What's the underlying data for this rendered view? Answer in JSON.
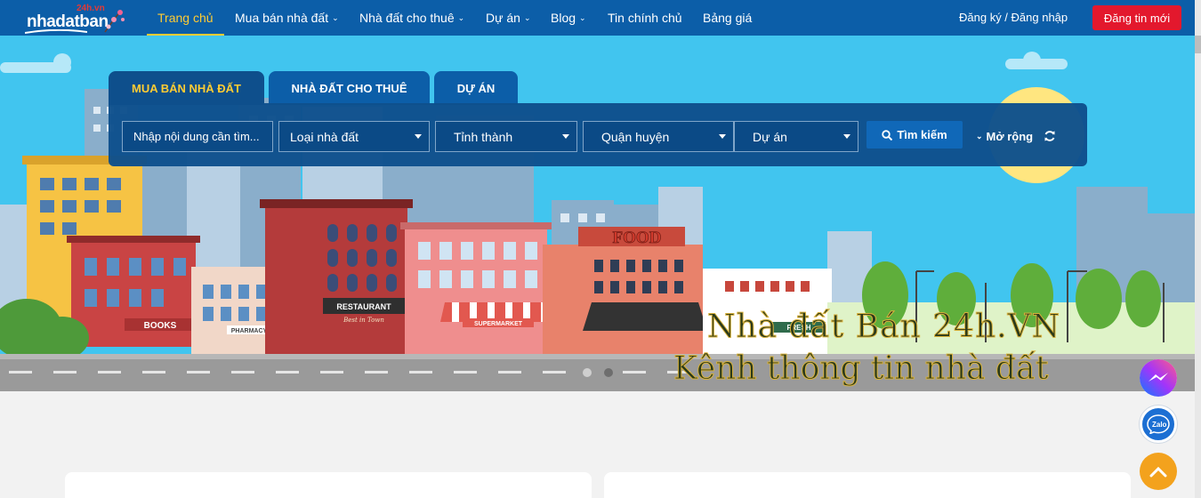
{
  "header": {
    "logo_text": "nhadatban",
    "logo_tag": "24h.vn",
    "nav": [
      {
        "label": "Trang chủ",
        "active": true,
        "dropdown": false
      },
      {
        "label": "Mua bán nhà đất",
        "active": false,
        "dropdown": true
      },
      {
        "label": "Nhà đất cho thuê",
        "active": false,
        "dropdown": true
      },
      {
        "label": "Dự án",
        "active": false,
        "dropdown": true
      },
      {
        "label": "Blog",
        "active": false,
        "dropdown": true
      },
      {
        "label": "Tin chính chủ",
        "active": false,
        "dropdown": false
      },
      {
        "label": "Bảng giá",
        "active": false,
        "dropdown": false
      }
    ],
    "auth_label": "Đăng ký / Đăng nhập",
    "post_button": "Đăng tin mới"
  },
  "search": {
    "tabs": [
      {
        "label": "MUA BÁN NHÀ ĐẤT",
        "active": true
      },
      {
        "label": "NHÀ ĐẤT CHO THUÊ",
        "active": false
      },
      {
        "label": "DỰ ÁN",
        "active": false
      }
    ],
    "keyword_placeholder": "Nhập nội dung cần tìm...",
    "selects": {
      "property_type": "Loại nhà đất",
      "province": "Tỉnh thành",
      "district": "Quận huyện",
      "project": "Dự án"
    },
    "search_button": "Tìm kiếm",
    "expand_label": "Mở rộng"
  },
  "banner": {
    "line1": "Nhà đất Bán 24h.VN",
    "line2": "Kênh thông tin nhà đất",
    "shop_signs": {
      "food": "FOOD",
      "restaurant": "RESTAURANT",
      "restaurant_sub": "Best in Town",
      "books": "BOOKS",
      "pharmacy": "PHARMACY",
      "supermarket": "SUPERMARKET",
      "fresh": "FRESH"
    },
    "slides": 2,
    "active_slide": 2
  },
  "floating": {
    "zalo_label": "Zalo"
  },
  "colors": {
    "header_bg": "#0c5ea8",
    "accent_yellow": "#ffcc33",
    "post_button_bg": "#e3182d",
    "panel_bg": "#0e4f8c",
    "sky": "#41c5ef",
    "scroll_top_bg": "#f3a21d"
  }
}
